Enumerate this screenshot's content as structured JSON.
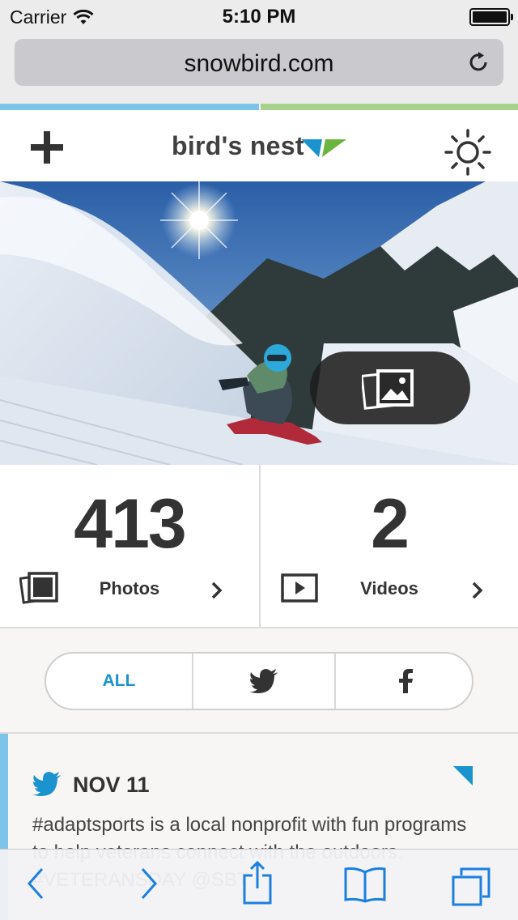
{
  "status_bar": {
    "carrier": "Carrier",
    "time": "5:10 PM",
    "battery_level": 1.0
  },
  "browser": {
    "url": "snowbird.com"
  },
  "app": {
    "brand_name": "bird's nest",
    "brand_colors": {
      "blue": "#1a93cf",
      "green": "#6bb43f"
    }
  },
  "hero": {
    "gallery_icon": "gallery-icon"
  },
  "stats": {
    "photos": {
      "count": "413",
      "label": "Photos"
    },
    "videos": {
      "count": "2",
      "label": "Videos"
    }
  },
  "filter": {
    "all_label": "ALL",
    "selected": "ALL",
    "options": [
      "ALL",
      "twitter",
      "facebook"
    ]
  },
  "feed": [
    {
      "source": "twitter",
      "date": "NOV 11",
      "text": "#adaptsports is a local nonprofit with fun programs to help veterans connect with the outdoors. #VETERANSDAY @SBT"
    }
  ],
  "toolbar": {
    "items": [
      "back-icon",
      "forward-icon",
      "share-icon",
      "bookmarks-icon",
      "tabs-icon"
    ]
  }
}
